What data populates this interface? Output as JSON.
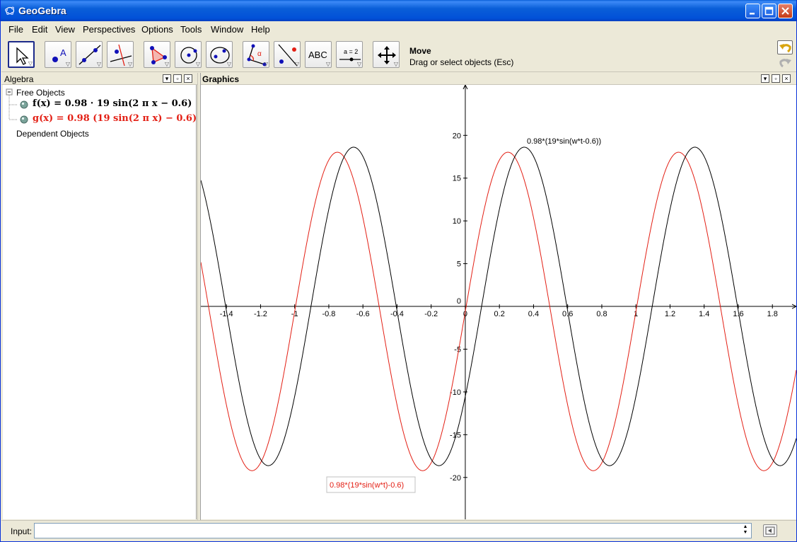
{
  "app": {
    "title": "GeoGebra"
  },
  "menu": [
    "File",
    "Edit",
    "View",
    "Perspectives",
    "Options",
    "Tools",
    "Window",
    "Help"
  ],
  "toolbar": {
    "tools": [
      {
        "name": "move-tool",
        "icon": "arrow-cursor-icon"
      },
      {
        "name": "point-tool",
        "icon": "point-icon",
        "glyph": "A"
      },
      {
        "name": "line-tool",
        "icon": "line-through-points-icon"
      },
      {
        "name": "perpendicular-tool",
        "icon": "perpendicular-line-icon"
      },
      {
        "name": "polygon-tool",
        "icon": "polygon-icon"
      },
      {
        "name": "circle-tool",
        "icon": "circle-center-point-icon"
      },
      {
        "name": "conic-tool",
        "icon": "ellipse-icon"
      },
      {
        "name": "angle-tool",
        "icon": "angle-icon",
        "glyph": "α"
      },
      {
        "name": "reflect-tool",
        "icon": "reflect-icon"
      },
      {
        "name": "text-tool",
        "icon": "text-icon",
        "glyph": "ABC"
      },
      {
        "name": "slider-tool",
        "icon": "slider-icon",
        "glyph": "a = 2"
      },
      {
        "name": "move-view-tool",
        "icon": "move-graphics-icon"
      }
    ],
    "active_tool_title": "Move",
    "active_tool_help": "Drag or select objects (Esc)",
    "undo_icon": "undo-icon",
    "redo_icon": "redo-icon"
  },
  "algebra": {
    "title": "Algebra",
    "free_objects_label": "Free Objects",
    "dependent_objects_label": "Dependent Objects",
    "objects": [
      {
        "label": "f(x) = 0.98 · 19 sin(2 π x − 0.6)",
        "color": "#000000"
      },
      {
        "label": "g(x) = 0.98 (19 sin(2 π x) − 0.6)",
        "color": "#e31f14"
      }
    ]
  },
  "graphics": {
    "title": "Graphics",
    "labels": {
      "f": "0.98*(19*sin(w*t-0.6))",
      "g": "0.98*(19*sin(w*t)-0.6)"
    }
  },
  "chart_data": {
    "type": "line",
    "title": "",
    "xlabel": "",
    "ylabel": "",
    "xlim": [
      -1.55,
      1.94
    ],
    "ylim": [
      -24.9,
      25.9
    ],
    "grid": false,
    "x_ticks": [
      -1.4,
      -1.2,
      -1,
      -0.8,
      -0.6,
      -0.4,
      -0.2,
      0,
      0.2,
      0.4,
      0.6,
      0.8,
      1,
      1.2,
      1.4,
      1.6,
      1.8
    ],
    "y_ticks": [
      -20,
      -15,
      -10,
      -5,
      0,
      5,
      10,
      15,
      20
    ],
    "series": [
      {
        "name": "f(x)",
        "expression": "0.98*19*sin(2*pi*x - 0.6)",
        "amplitude": 18.62,
        "frequency": 1,
        "phase": -0.6,
        "offset": 0,
        "color": "#000000"
      },
      {
        "name": "g(x)",
        "expression": "0.98*(19*sin(2*pi*x) - 0.6)",
        "amplitude": 18.62,
        "frequency": 1,
        "phase": 0,
        "offset": -0.588,
        "color": "#e31f14"
      }
    ]
  },
  "input": {
    "label": "Input:",
    "value": ""
  }
}
